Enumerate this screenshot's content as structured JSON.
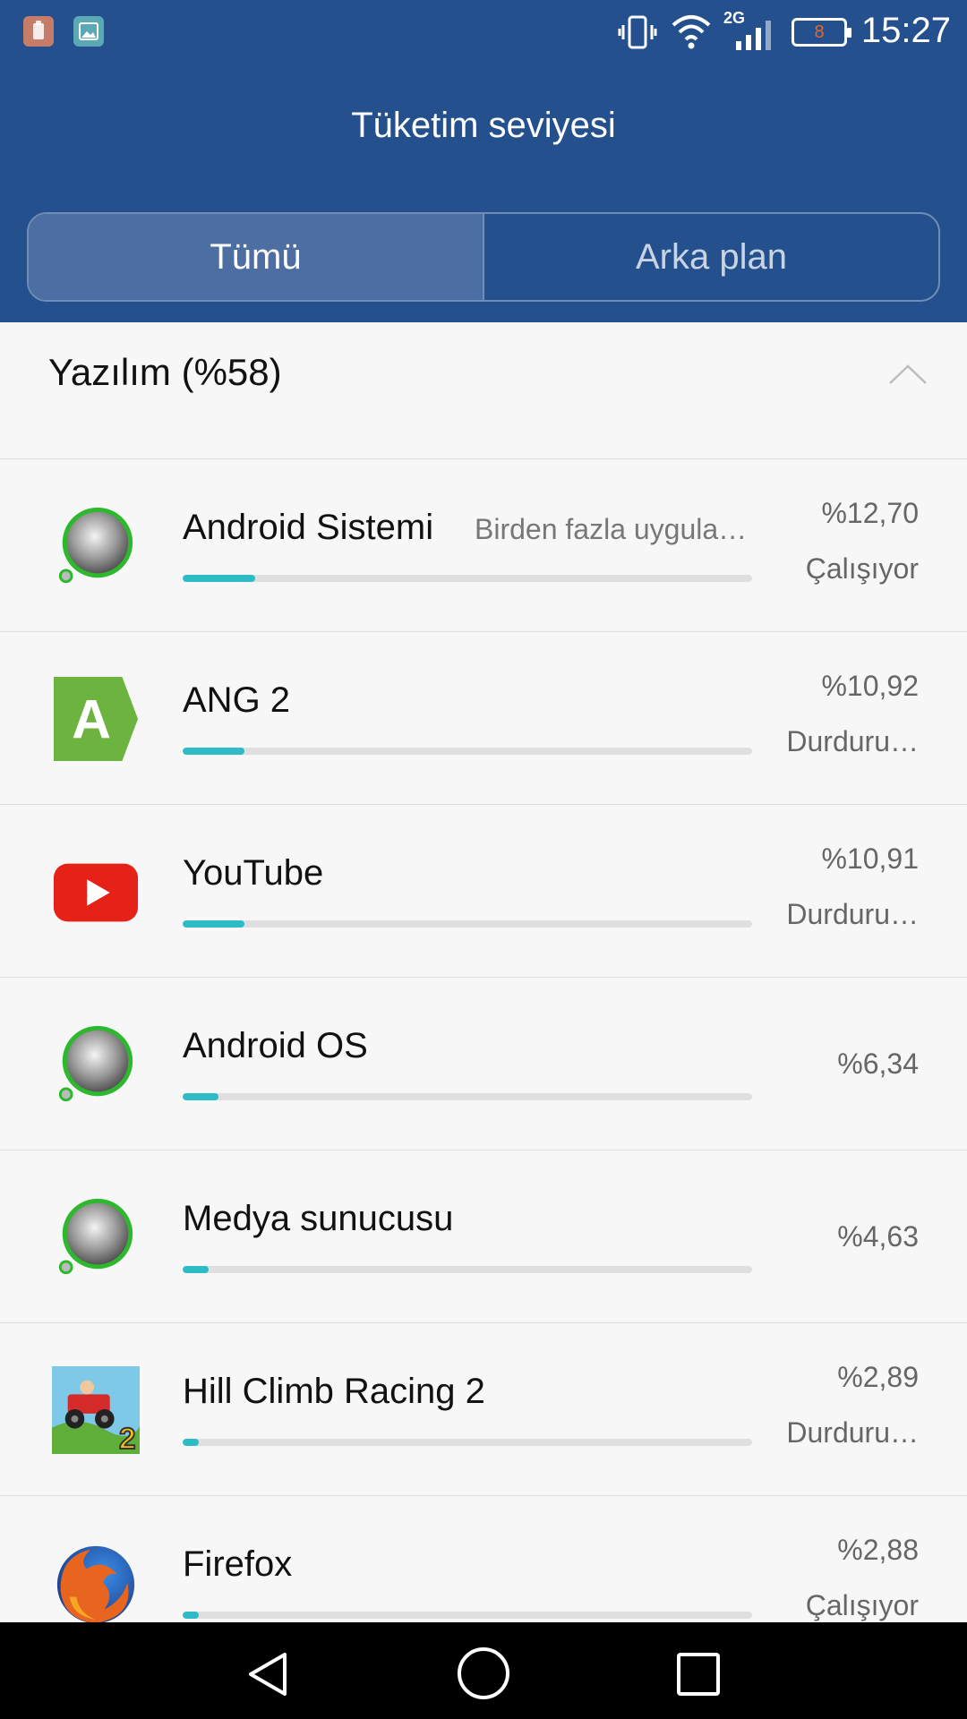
{
  "status_bar": {
    "time": "15:27",
    "battery_level": "8",
    "network": "2G",
    "icons": [
      "clipboard-icon",
      "gallery-icon",
      "vibrate-icon",
      "wifi-icon",
      "signal-icon",
      "battery-icon"
    ]
  },
  "header": {
    "title": "Tüketim seviyesi",
    "tabs": [
      {
        "label": "Tümü",
        "active": true
      },
      {
        "label": "Arka plan",
        "active": false
      }
    ]
  },
  "section": {
    "title": "Yazılım (%58)",
    "icon": "chevron-up-icon"
  },
  "colors": {
    "header_bg": "#24518e",
    "active_tab_bg": "#4c6ea2",
    "progress_fill": "#2dbcc7",
    "progress_track": "#dfdfdf",
    "list_bg": "#f7f7f7"
  },
  "apps": [
    {
      "name": "Android Sistemi",
      "extra": "Birden fazla uygula…",
      "percent": "%12,70",
      "state": "Çalışıyor",
      "usage": 0.127,
      "icon": "android-system-icon"
    },
    {
      "name": "ANG 2",
      "extra": "",
      "percent": "%10,92",
      "state": "Durduru…",
      "usage": 0.1092,
      "icon": "ang2-icon"
    },
    {
      "name": "YouTube",
      "extra": "",
      "percent": "%10,91",
      "state": "Durduru…",
      "usage": 0.1091,
      "icon": "youtube-icon"
    },
    {
      "name": "Android OS",
      "extra": "",
      "percent": "%6,34",
      "state": "",
      "usage": 0.0634,
      "icon": "android-os-icon"
    },
    {
      "name": "Medya sunucusu",
      "extra": "",
      "percent": "%4,63",
      "state": "",
      "usage": 0.0463,
      "icon": "media-server-icon"
    },
    {
      "name": "Hill Climb Racing 2",
      "extra": "",
      "percent": "%2,89",
      "state": "Durduru…",
      "usage": 0.0289,
      "icon": "hill-climb-racing-icon"
    },
    {
      "name": "Firefox",
      "extra": "",
      "percent": "%2,88",
      "state": "Çalışıyor",
      "usage": 0.0288,
      "icon": "firefox-icon"
    }
  ],
  "nav_bar": {
    "buttons": [
      "back-icon",
      "home-icon",
      "recents-icon"
    ]
  }
}
